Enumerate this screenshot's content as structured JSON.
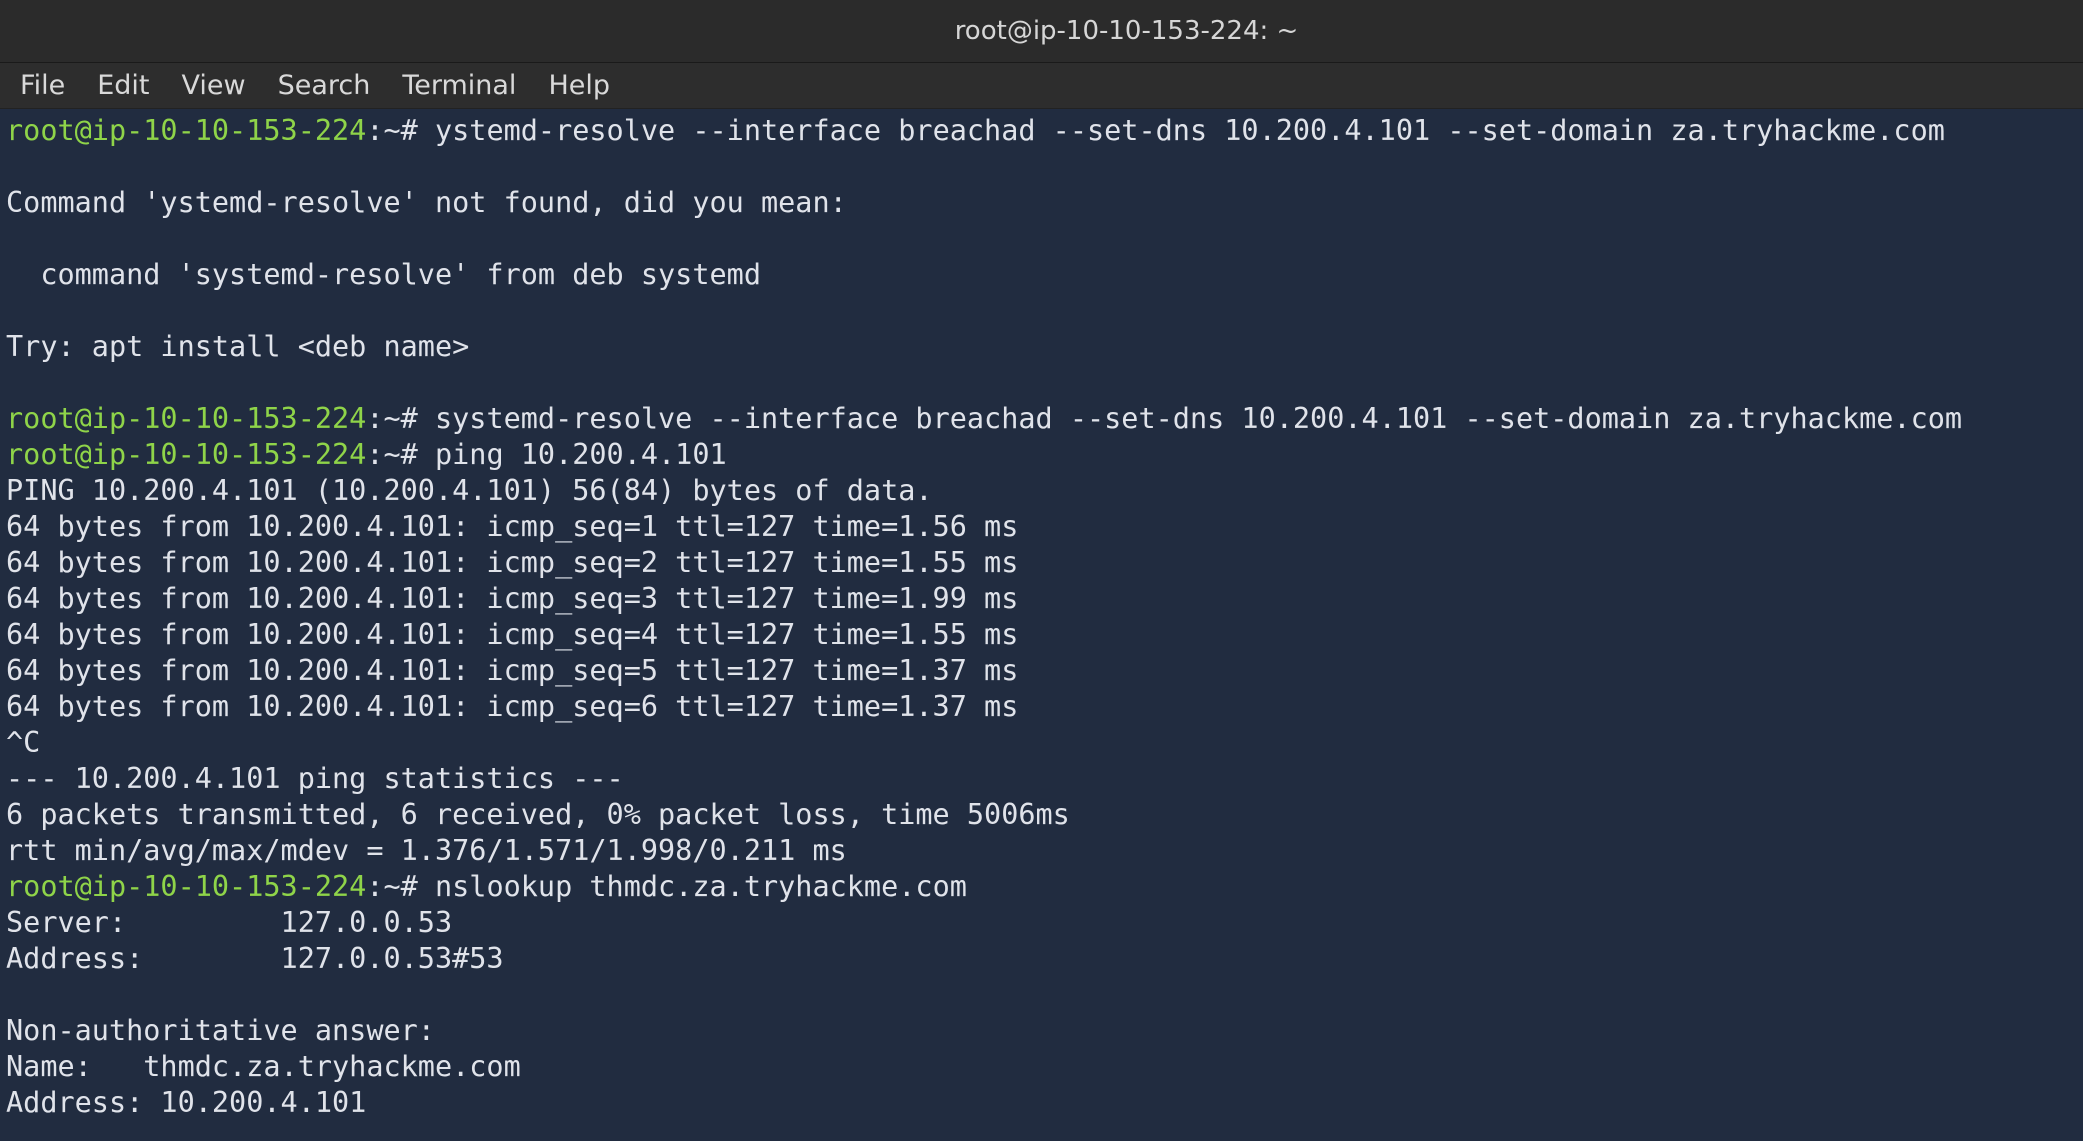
{
  "window": {
    "title": "root@ip-10-10-153-224: ~"
  },
  "menu": [
    {
      "label": "File"
    },
    {
      "label": "Edit"
    },
    {
      "label": "View"
    },
    {
      "label": "Search"
    },
    {
      "label": "Terminal"
    },
    {
      "label": "Help"
    }
  ],
  "terminal": {
    "prompt_user": "root@ip-10-10-153-224",
    "prompt_suffix": ":~# ",
    "lines": [
      {
        "prompt": true,
        "text": "ystemd-resolve --interface breachad --set-dns 10.200.4.101 --set-domain za.tryhackme.com"
      },
      {
        "prompt": false,
        "text": ""
      },
      {
        "prompt": false,
        "text": "Command 'ystemd-resolve' not found, did you mean:"
      },
      {
        "prompt": false,
        "text": ""
      },
      {
        "prompt": false,
        "text": "  command 'systemd-resolve' from deb systemd"
      },
      {
        "prompt": false,
        "text": ""
      },
      {
        "prompt": false,
        "text": "Try: apt install <deb name>"
      },
      {
        "prompt": false,
        "text": ""
      },
      {
        "prompt": true,
        "text": "systemd-resolve --interface breachad --set-dns 10.200.4.101 --set-domain za.tryhackme.com"
      },
      {
        "prompt": true,
        "text": "ping 10.200.4.101"
      },
      {
        "prompt": false,
        "text": "PING 10.200.4.101 (10.200.4.101) 56(84) bytes of data."
      },
      {
        "prompt": false,
        "text": "64 bytes from 10.200.4.101: icmp_seq=1 ttl=127 time=1.56 ms"
      },
      {
        "prompt": false,
        "text": "64 bytes from 10.200.4.101: icmp_seq=2 ttl=127 time=1.55 ms"
      },
      {
        "prompt": false,
        "text": "64 bytes from 10.200.4.101: icmp_seq=3 ttl=127 time=1.99 ms"
      },
      {
        "prompt": false,
        "text": "64 bytes from 10.200.4.101: icmp_seq=4 ttl=127 time=1.55 ms"
      },
      {
        "prompt": false,
        "text": "64 bytes from 10.200.4.101: icmp_seq=5 ttl=127 time=1.37 ms"
      },
      {
        "prompt": false,
        "text": "64 bytes from 10.200.4.101: icmp_seq=6 ttl=127 time=1.37 ms"
      },
      {
        "prompt": false,
        "text": "^C"
      },
      {
        "prompt": false,
        "text": "--- 10.200.4.101 ping statistics ---"
      },
      {
        "prompt": false,
        "text": "6 packets transmitted, 6 received, 0% packet loss, time 5006ms"
      },
      {
        "prompt": false,
        "text": "rtt min/avg/max/mdev = 1.376/1.571/1.998/0.211 ms"
      },
      {
        "prompt": true,
        "text": "nslookup thmdc.za.tryhackme.com"
      },
      {
        "prompt": false,
        "text": "Server:\t\t127.0.0.53"
      },
      {
        "prompt": false,
        "text": "Address:\t127.0.0.53#53"
      },
      {
        "prompt": false,
        "text": ""
      },
      {
        "prompt": false,
        "text": "Non-authoritative answer:"
      },
      {
        "prompt": false,
        "text": "Name:\tthmdc.za.tryhackme.com"
      },
      {
        "prompt": false,
        "text": "Address: 10.200.4.101"
      }
    ]
  },
  "colors": {
    "prompt": "#8fd449",
    "text": "#e0e3ea",
    "background": "#212c40",
    "titlebar": "#2b2b2b"
  }
}
